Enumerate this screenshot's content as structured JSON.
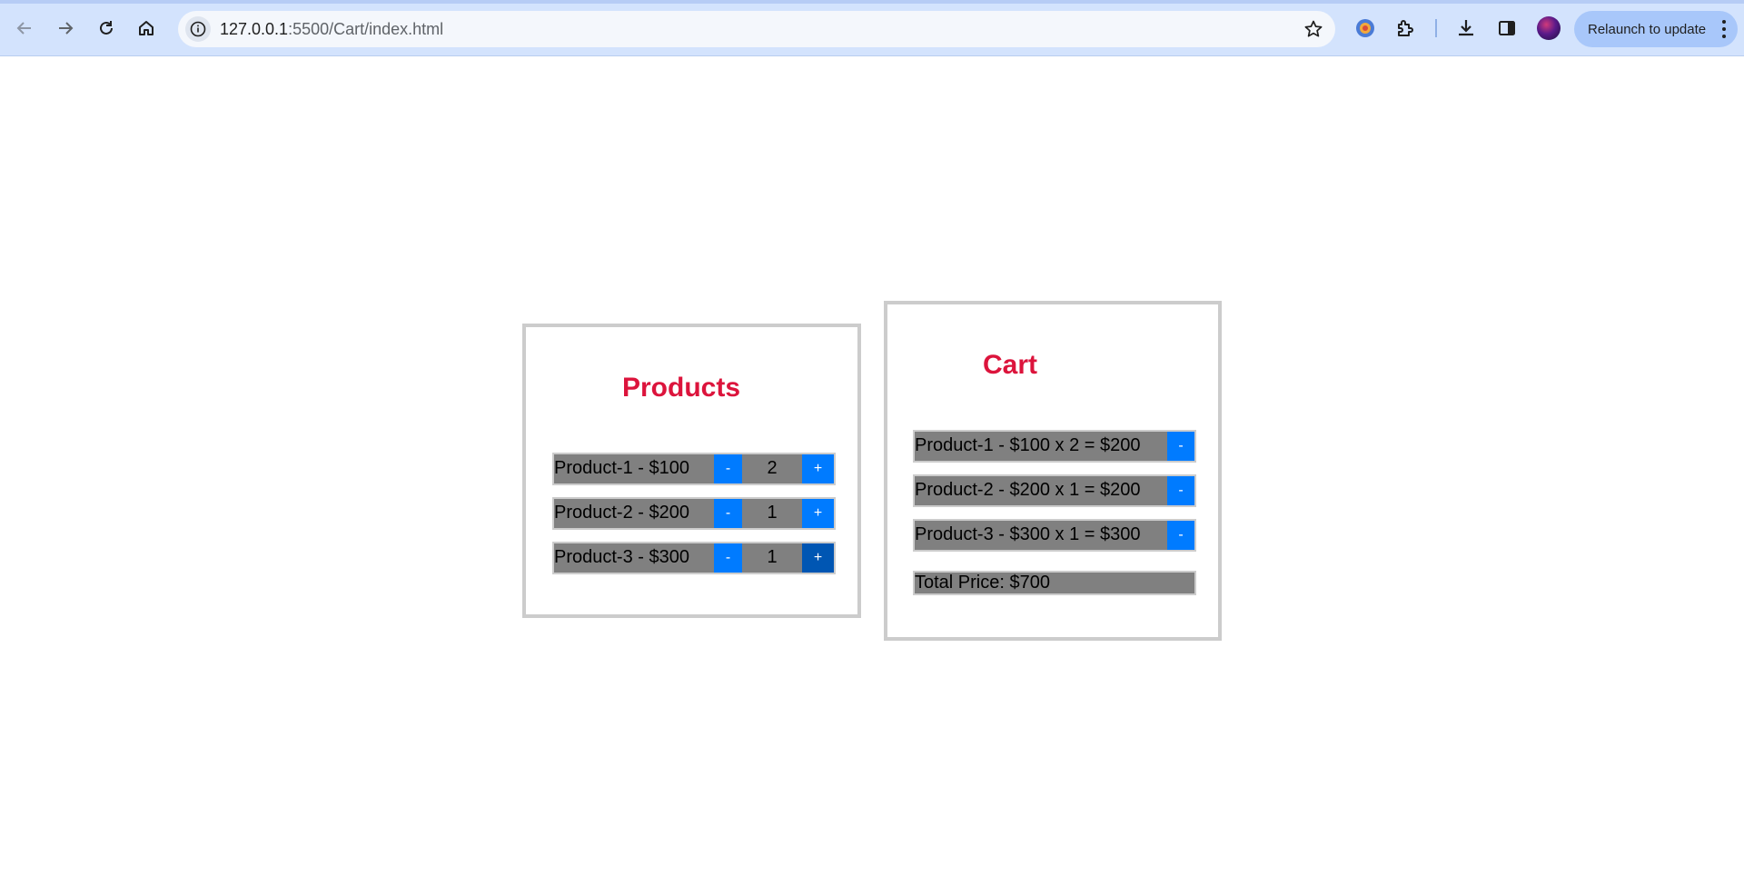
{
  "browser": {
    "url_host": "127.0.0.1",
    "url_rest": ":5500/Cart/index.html",
    "relaunch_label": "Relaunch to update"
  },
  "products": {
    "title": "Products",
    "items": [
      {
        "label": "Product-1 - $100",
        "minus": "-",
        "qty": "2",
        "plus": "+"
      },
      {
        "label": "Product-2 - $200",
        "minus": "-",
        "qty": "1",
        "plus": "+"
      },
      {
        "label": "Product-3 - $300",
        "minus": "-",
        "qty": "1",
        "plus": "+"
      }
    ]
  },
  "cart": {
    "title": "Cart",
    "items": [
      {
        "label": "Product-1 - $100 x 2 = $200",
        "remove": "-"
      },
      {
        "label": "Product-2 - $200 x 1 = $200",
        "remove": "-"
      },
      {
        "label": "Product-3 - $300 x 1 = $300",
        "remove": "-"
      }
    ],
    "total": "Total Price: $700"
  },
  "colors": {
    "title": "#dc143c",
    "button": "#007bff",
    "button_hover": "#0056b3",
    "row_bg": "#808080"
  }
}
